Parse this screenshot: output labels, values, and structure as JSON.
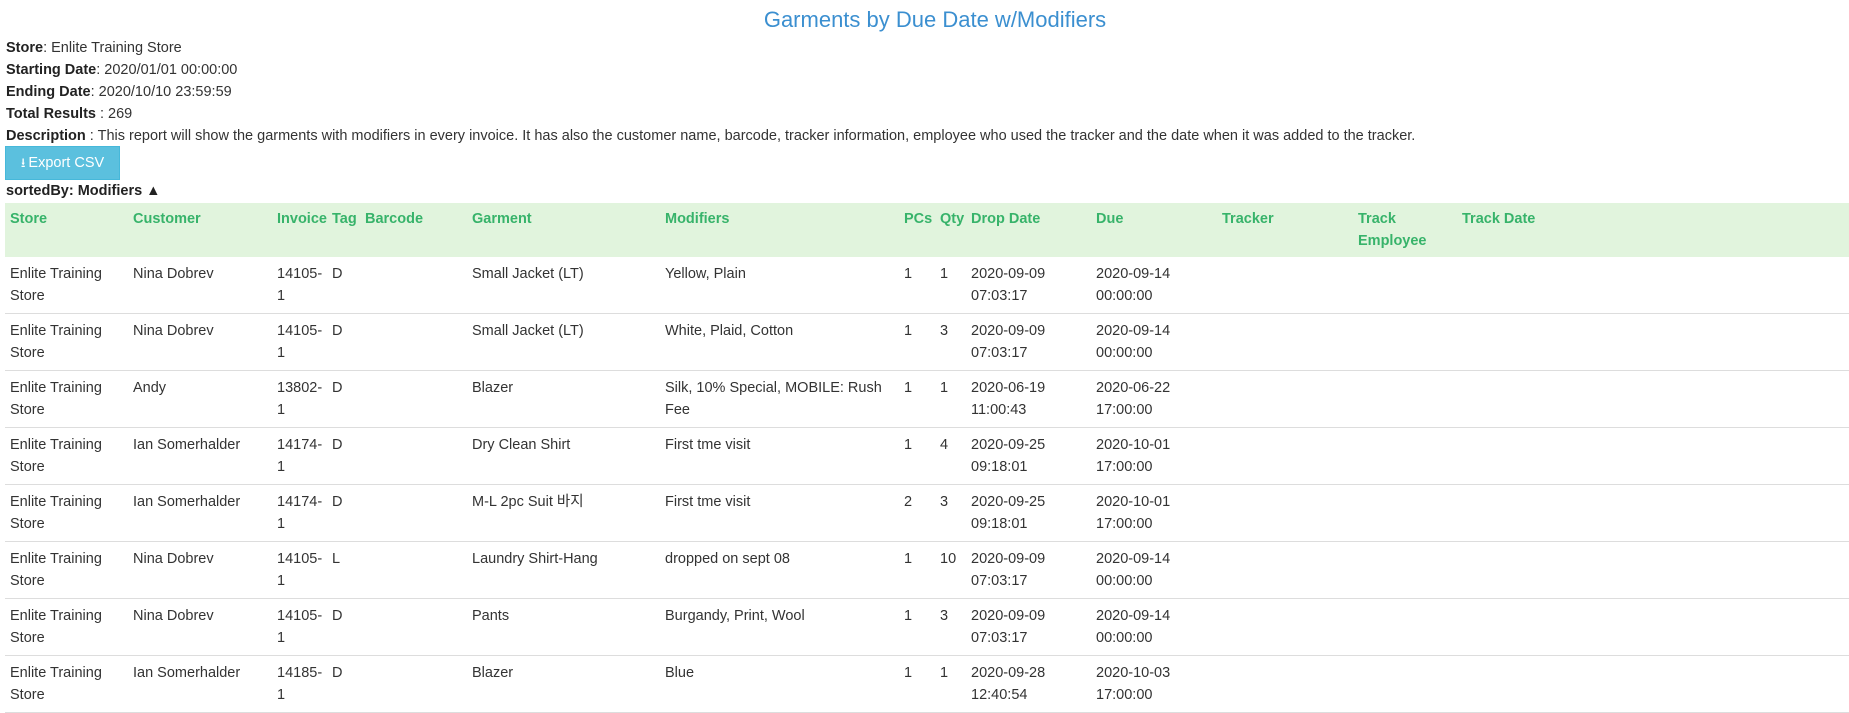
{
  "report": {
    "title": "Garments by Due Date w/Modifiers",
    "store_label": "Store",
    "store_value": ": Enlite Training Store",
    "start_label": "Starting Date",
    "start_value": ": 2020/01/01 00:00:00",
    "end_label": "Ending Date",
    "end_value": ": 2020/10/10 23:59:59",
    "total_label": "Total Results",
    "total_value": " : 269",
    "desc_label": "Description",
    "desc_value": " : This report will show the garments with modifiers in every invoice. It has also the customer name, barcode, tracker information, employee who used the tracker and the date when it was added to the tracker.",
    "export_label": "Export CSV",
    "export_icon": "download-icon",
    "sorted_by": "sortedBy: Modifiers ▲"
  },
  "colors": {
    "title": "#3b8fd0",
    "header_bg": "#e1f4dd",
    "header_text": "#37b36a",
    "button_bg": "#5bc0de"
  },
  "table": {
    "columns": [
      "Store",
      "Customer",
      "Invoice",
      "Tag",
      "Barcode",
      "Garment",
      "Modifiers",
      "PCs",
      "Qty",
      "Drop Date",
      "Due",
      "Tracker",
      "Track Employee",
      "Track Date"
    ],
    "rows": [
      [
        "Enlite Training Store",
        "Nina Dobrev",
        "14105-1",
        "D",
        "",
        "Small Jacket (LT)",
        "Yellow, Plain",
        "1",
        "1",
        "2020-09-09 07:03:17",
        "2020-09-14 00:00:00",
        "",
        "",
        ""
      ],
      [
        "Enlite Training Store",
        "Nina Dobrev",
        "14105-1",
        "D",
        "",
        "Small Jacket (LT)",
        "White, Plaid, Cotton",
        "1",
        "3",
        "2020-09-09 07:03:17",
        "2020-09-14 00:00:00",
        "",
        "",
        ""
      ],
      [
        "Enlite Training Store",
        "Andy",
        "13802-1",
        "D",
        "",
        "Blazer",
        "Silk, 10% Special, MOBILE: Rush Fee",
        "1",
        "1",
        "2020-06-19 11:00:43",
        "2020-06-22 17:00:00",
        "",
        "",
        ""
      ],
      [
        "Enlite Training Store",
        "Ian Somerhalder",
        "14174-1",
        "D",
        "",
        "Dry Clean Shirt",
        "First tme visit",
        "1",
        "4",
        "2020-09-25 09:18:01",
        "2020-10-01 17:00:00",
        "",
        "",
        ""
      ],
      [
        "Enlite Training Store",
        "Ian Somerhalder",
        "14174-1",
        "D",
        "",
        "M-L 2pc Suit 바지",
        "First tme visit",
        "2",
        "3",
        "2020-09-25 09:18:01",
        "2020-10-01 17:00:00",
        "",
        "",
        ""
      ],
      [
        "Enlite Training Store",
        "Nina Dobrev",
        "14105-1",
        "L",
        "",
        "Laundry Shirt-Hang",
        "dropped on sept 08",
        "1",
        "10",
        "2020-09-09 07:03:17",
        "2020-09-14 00:00:00",
        "",
        "",
        ""
      ],
      [
        "Enlite Training Store",
        "Nina Dobrev",
        "14105-1",
        "D",
        "",
        "Pants",
        "Burgandy, Print, Wool",
        "1",
        "3",
        "2020-09-09 07:03:17",
        "2020-09-14 00:00:00",
        "",
        "",
        ""
      ],
      [
        "Enlite Training Store",
        "Ian Somerhalder",
        "14185-1",
        "D",
        "",
        "Blazer",
        "Blue",
        "1",
        "1",
        "2020-09-28 12:40:54",
        "2020-10-03 17:00:00",
        "",
        "",
        ""
      ]
    ]
  }
}
